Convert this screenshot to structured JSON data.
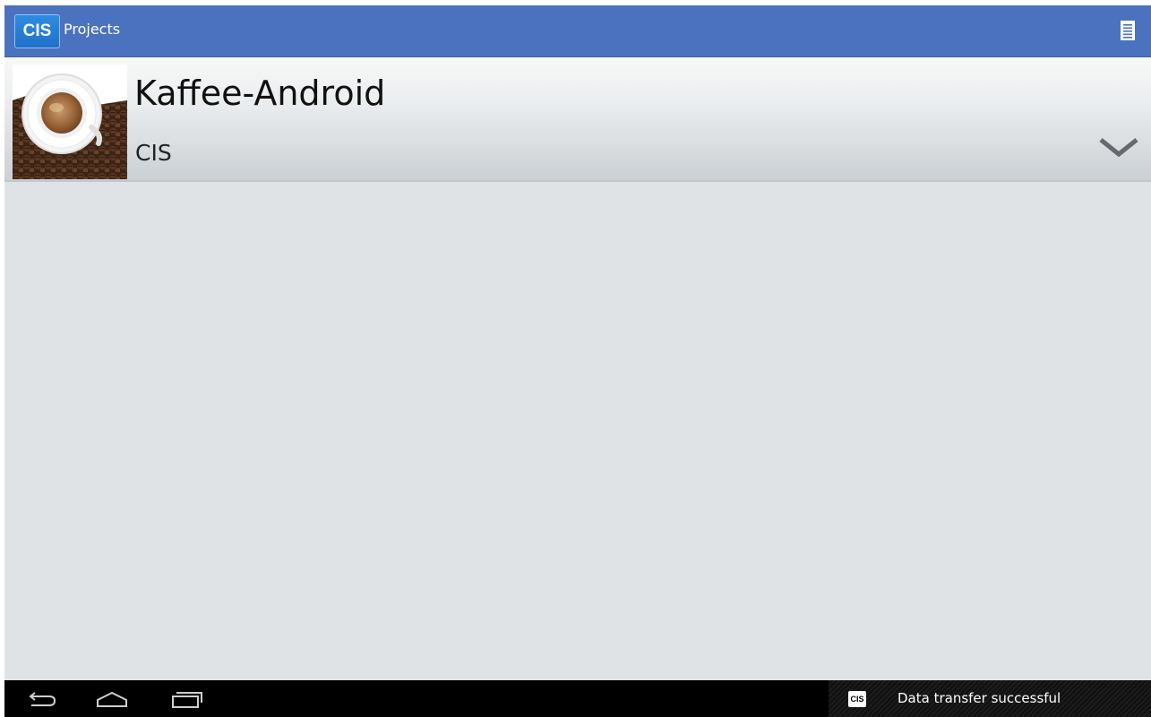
{
  "action_bar": {
    "logo_text": "CIS",
    "title": "Projects",
    "menu_icon": "overflow-menu-icon",
    "color": "#4b72be"
  },
  "projects": [
    {
      "name": "Kaffee-Android",
      "organization": "CIS",
      "thumbnail": "coffee-cup-image",
      "expand_icon": "chevron-down-icon"
    }
  ],
  "nav_bar": {
    "back_icon": "back-icon",
    "home_icon": "home-icon",
    "recents_icon": "recent-apps-icon"
  },
  "notification": {
    "icon_text": "CIS",
    "text": "Data transfer successful"
  }
}
